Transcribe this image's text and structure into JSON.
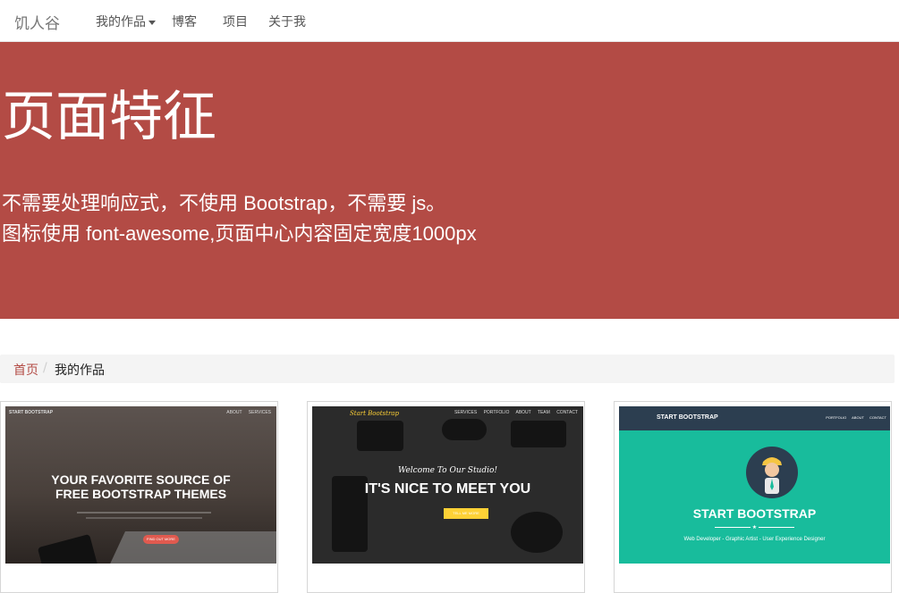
{
  "navbar": {
    "brand": "饥人谷",
    "items": [
      {
        "label": "我的作品",
        "has_dropdown": true
      },
      {
        "label": "博客"
      },
      {
        "label": "项目"
      },
      {
        "label": "关于我"
      }
    ]
  },
  "hero": {
    "title": "页面特征",
    "line1": "不需要处理响应式，不使用 Bootstrap，不需要 js。",
    "line2": "图标使用 font-awesome,页面中心内容固定宽度1000px",
    "background_color": "#b34b45"
  },
  "breadcrumb": {
    "home": "首页",
    "separator": "/",
    "current": "我的作品"
  },
  "cards": [
    {
      "nav_brand": "START BOOTSTRAP",
      "nav_links": "ABOUT SERVICES",
      "heading_line1": "YOUR FAVORITE SOURCE OF",
      "heading_line2": "FREE BOOTSTRAP THEMES",
      "button": "FIND OUT MORE"
    },
    {
      "nav_brand": "Start Bootstrap",
      "nav_links": "SERVICES PORTFOLIO ABOUT TEAM CONTACT",
      "welcome": "Welcome To Our Studio!",
      "heading": "IT'S NICE TO MEET YOU",
      "button": "TELL ME MORE"
    },
    {
      "nav_brand": "START BOOTSTRAP",
      "nav_links": "PORTFOLIO ABOUT CONTACT",
      "heading": "START BOOTSTRAP",
      "star": "★",
      "subtitle": "Web Developer - Graphic Artist - User Experience Designer"
    }
  ]
}
